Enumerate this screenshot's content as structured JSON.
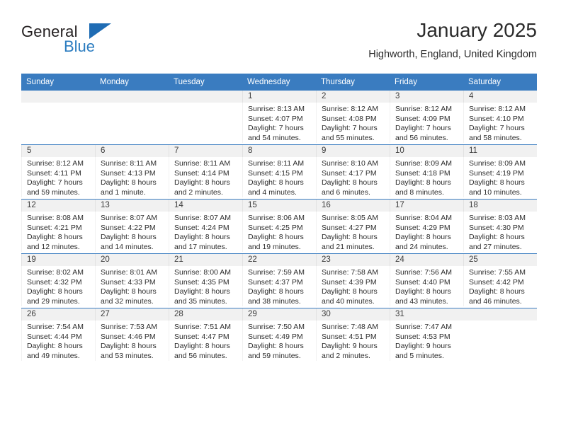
{
  "brand": {
    "name_part1": "General",
    "name_part2": "Blue",
    "logo_icon": "blue-triangle-icon",
    "accent_color": "#2b7cc0"
  },
  "header": {
    "title": "January 2025",
    "subtitle": "Highworth, England, United Kingdom"
  },
  "calendar": {
    "header_bg": "#3a7cc0",
    "daynum_bg": "#f1f1f1",
    "weekdays": [
      "Sunday",
      "Monday",
      "Tuesday",
      "Wednesday",
      "Thursday",
      "Friday",
      "Saturday"
    ],
    "weeks": [
      [
        {
          "day": "",
          "empty": true
        },
        {
          "day": "",
          "empty": true
        },
        {
          "day": "",
          "empty": true
        },
        {
          "day": "1",
          "sunrise": "Sunrise: 8:13 AM",
          "sunset": "Sunset: 4:07 PM",
          "daylight1": "Daylight: 7 hours",
          "daylight2": "and 54 minutes."
        },
        {
          "day": "2",
          "sunrise": "Sunrise: 8:12 AM",
          "sunset": "Sunset: 4:08 PM",
          "daylight1": "Daylight: 7 hours",
          "daylight2": "and 55 minutes."
        },
        {
          "day": "3",
          "sunrise": "Sunrise: 8:12 AM",
          "sunset": "Sunset: 4:09 PM",
          "daylight1": "Daylight: 7 hours",
          "daylight2": "and 56 minutes."
        },
        {
          "day": "4",
          "sunrise": "Sunrise: 8:12 AM",
          "sunset": "Sunset: 4:10 PM",
          "daylight1": "Daylight: 7 hours",
          "daylight2": "and 58 minutes."
        }
      ],
      [
        {
          "day": "5",
          "sunrise": "Sunrise: 8:12 AM",
          "sunset": "Sunset: 4:11 PM",
          "daylight1": "Daylight: 7 hours",
          "daylight2": "and 59 minutes."
        },
        {
          "day": "6",
          "sunrise": "Sunrise: 8:11 AM",
          "sunset": "Sunset: 4:13 PM",
          "daylight1": "Daylight: 8 hours",
          "daylight2": "and 1 minute."
        },
        {
          "day": "7",
          "sunrise": "Sunrise: 8:11 AM",
          "sunset": "Sunset: 4:14 PM",
          "daylight1": "Daylight: 8 hours",
          "daylight2": "and 2 minutes."
        },
        {
          "day": "8",
          "sunrise": "Sunrise: 8:11 AM",
          "sunset": "Sunset: 4:15 PM",
          "daylight1": "Daylight: 8 hours",
          "daylight2": "and 4 minutes."
        },
        {
          "day": "9",
          "sunrise": "Sunrise: 8:10 AM",
          "sunset": "Sunset: 4:17 PM",
          "daylight1": "Daylight: 8 hours",
          "daylight2": "and 6 minutes."
        },
        {
          "day": "10",
          "sunrise": "Sunrise: 8:09 AM",
          "sunset": "Sunset: 4:18 PM",
          "daylight1": "Daylight: 8 hours",
          "daylight2": "and 8 minutes."
        },
        {
          "day": "11",
          "sunrise": "Sunrise: 8:09 AM",
          "sunset": "Sunset: 4:19 PM",
          "daylight1": "Daylight: 8 hours",
          "daylight2": "and 10 minutes."
        }
      ],
      [
        {
          "day": "12",
          "sunrise": "Sunrise: 8:08 AM",
          "sunset": "Sunset: 4:21 PM",
          "daylight1": "Daylight: 8 hours",
          "daylight2": "and 12 minutes."
        },
        {
          "day": "13",
          "sunrise": "Sunrise: 8:07 AM",
          "sunset": "Sunset: 4:22 PM",
          "daylight1": "Daylight: 8 hours",
          "daylight2": "and 14 minutes."
        },
        {
          "day": "14",
          "sunrise": "Sunrise: 8:07 AM",
          "sunset": "Sunset: 4:24 PM",
          "daylight1": "Daylight: 8 hours",
          "daylight2": "and 17 minutes."
        },
        {
          "day": "15",
          "sunrise": "Sunrise: 8:06 AM",
          "sunset": "Sunset: 4:25 PM",
          "daylight1": "Daylight: 8 hours",
          "daylight2": "and 19 minutes."
        },
        {
          "day": "16",
          "sunrise": "Sunrise: 8:05 AM",
          "sunset": "Sunset: 4:27 PM",
          "daylight1": "Daylight: 8 hours",
          "daylight2": "and 21 minutes."
        },
        {
          "day": "17",
          "sunrise": "Sunrise: 8:04 AM",
          "sunset": "Sunset: 4:29 PM",
          "daylight1": "Daylight: 8 hours",
          "daylight2": "and 24 minutes."
        },
        {
          "day": "18",
          "sunrise": "Sunrise: 8:03 AM",
          "sunset": "Sunset: 4:30 PM",
          "daylight1": "Daylight: 8 hours",
          "daylight2": "and 27 minutes."
        }
      ],
      [
        {
          "day": "19",
          "sunrise": "Sunrise: 8:02 AM",
          "sunset": "Sunset: 4:32 PM",
          "daylight1": "Daylight: 8 hours",
          "daylight2": "and 29 minutes."
        },
        {
          "day": "20",
          "sunrise": "Sunrise: 8:01 AM",
          "sunset": "Sunset: 4:33 PM",
          "daylight1": "Daylight: 8 hours",
          "daylight2": "and 32 minutes."
        },
        {
          "day": "21",
          "sunrise": "Sunrise: 8:00 AM",
          "sunset": "Sunset: 4:35 PM",
          "daylight1": "Daylight: 8 hours",
          "daylight2": "and 35 minutes."
        },
        {
          "day": "22",
          "sunrise": "Sunrise: 7:59 AM",
          "sunset": "Sunset: 4:37 PM",
          "daylight1": "Daylight: 8 hours",
          "daylight2": "and 38 minutes."
        },
        {
          "day": "23",
          "sunrise": "Sunrise: 7:58 AM",
          "sunset": "Sunset: 4:39 PM",
          "daylight1": "Daylight: 8 hours",
          "daylight2": "and 40 minutes."
        },
        {
          "day": "24",
          "sunrise": "Sunrise: 7:56 AM",
          "sunset": "Sunset: 4:40 PM",
          "daylight1": "Daylight: 8 hours",
          "daylight2": "and 43 minutes."
        },
        {
          "day": "25",
          "sunrise": "Sunrise: 7:55 AM",
          "sunset": "Sunset: 4:42 PM",
          "daylight1": "Daylight: 8 hours",
          "daylight2": "and 46 minutes."
        }
      ],
      [
        {
          "day": "26",
          "sunrise": "Sunrise: 7:54 AM",
          "sunset": "Sunset: 4:44 PM",
          "daylight1": "Daylight: 8 hours",
          "daylight2": "and 49 minutes."
        },
        {
          "day": "27",
          "sunrise": "Sunrise: 7:53 AM",
          "sunset": "Sunset: 4:46 PM",
          "daylight1": "Daylight: 8 hours",
          "daylight2": "and 53 minutes."
        },
        {
          "day": "28",
          "sunrise": "Sunrise: 7:51 AM",
          "sunset": "Sunset: 4:47 PM",
          "daylight1": "Daylight: 8 hours",
          "daylight2": "and 56 minutes."
        },
        {
          "day": "29",
          "sunrise": "Sunrise: 7:50 AM",
          "sunset": "Sunset: 4:49 PM",
          "daylight1": "Daylight: 8 hours",
          "daylight2": "and 59 minutes."
        },
        {
          "day": "30",
          "sunrise": "Sunrise: 7:48 AM",
          "sunset": "Sunset: 4:51 PM",
          "daylight1": "Daylight: 9 hours",
          "daylight2": "and 2 minutes."
        },
        {
          "day": "31",
          "sunrise": "Sunrise: 7:47 AM",
          "sunset": "Sunset: 4:53 PM",
          "daylight1": "Daylight: 9 hours",
          "daylight2": "and 5 minutes."
        },
        {
          "day": "",
          "empty": true
        }
      ]
    ]
  }
}
